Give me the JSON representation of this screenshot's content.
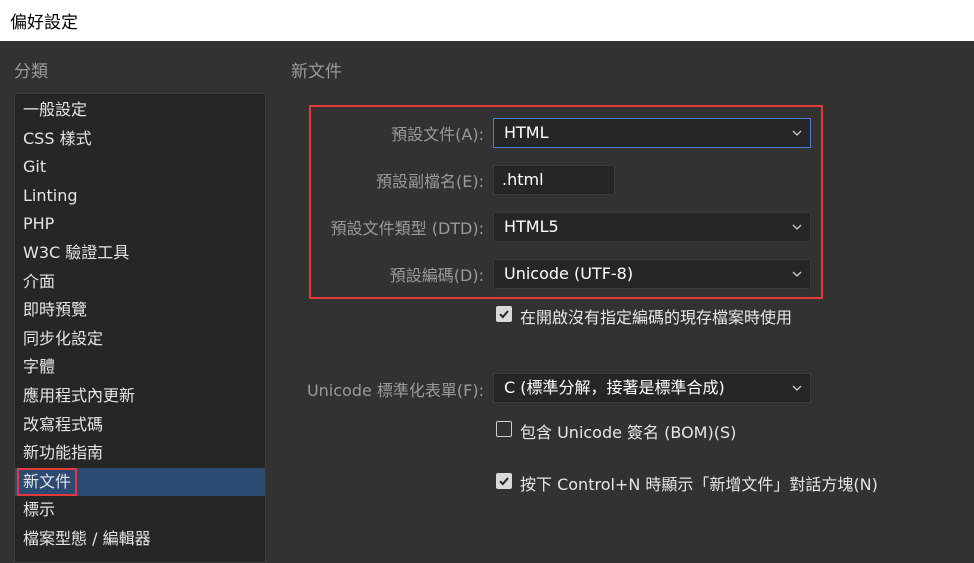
{
  "window": {
    "title": "偏好設定"
  },
  "categories": {
    "heading": "分類",
    "items": [
      "一般設定",
      "CSS 樣式",
      "Git",
      "Linting",
      "PHP",
      "W3C 驗證工具",
      "介面",
      "即時預覽",
      "同步化設定",
      "字體",
      "應用程式內更新",
      "改寫程式碼",
      "新功能指南",
      "新文件",
      "標示",
      "檔案型態 / 編輯器"
    ],
    "selected_index": 13
  },
  "panel": {
    "title": "新文件",
    "default_doc_label": "預設文件(A):",
    "default_doc_value": "HTML",
    "default_ext_label": "預設副檔名(E):",
    "default_ext_value": ".html",
    "default_dtd_label": "預設文件類型 (DTD):",
    "default_dtd_value": "HTML5",
    "default_encoding_label": "預設編碼(D):",
    "default_encoding_value": "Unicode (UTF-8)",
    "use_when_opening_label": "在開啟沒有指定編碼的現存檔案時使用",
    "use_when_opening_checked": true,
    "normalization_label": "Unicode 標準化表單(F):",
    "normalization_value": "C (標準分解，接著是標準合成)",
    "include_bom_label": "包含 Unicode 簽名 (BOM)(S)",
    "include_bom_checked": false,
    "show_dialog_label": "按下 Control+N 時顯示「新增文件」對話方塊(N)",
    "show_dialog_checked": true
  },
  "colors": {
    "highlight_border": "#e03a3a",
    "selected_bg": "#2d4a73",
    "focus_border": "#4a7fd4"
  }
}
